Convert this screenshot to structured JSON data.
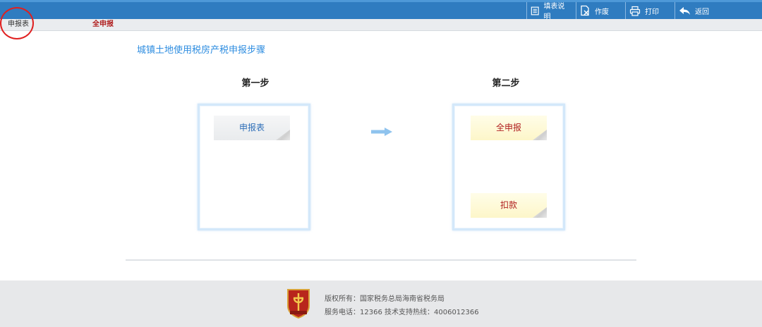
{
  "toolbar": {
    "guide_label": "填表说明",
    "void_label": "作废",
    "print_label": "打印",
    "back_label": "返回"
  },
  "tabs": {
    "form_label": "申报表",
    "full_label": "全申报"
  },
  "page": {
    "title": "城镇土地使用税房产税申报步骤"
  },
  "steps": {
    "step1_title": "第一步",
    "step2_title": "第二步",
    "form_button": "申报表",
    "full_button": "全申报",
    "deduct_button": "扣款"
  },
  "footer": {
    "copyright": "版权所有：国家税务总局海南省税务局",
    "service": "服务电话：12366 技术支持热线：4006012366"
  },
  "colors": {
    "topbar": "#2f7cc0",
    "title_blue": "#2e8de0",
    "accent_red": "#b01f1f",
    "annotation_red": "#e02020"
  }
}
